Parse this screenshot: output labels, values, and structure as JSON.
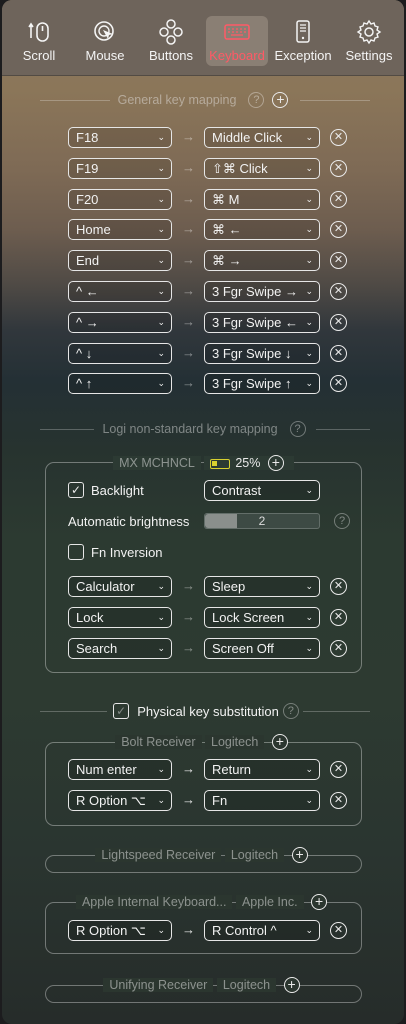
{
  "toolbar": {
    "items": [
      {
        "label": "Scroll",
        "icon": "scroll-icon"
      },
      {
        "label": "Mouse",
        "icon": "mouse-icon"
      },
      {
        "label": "Buttons",
        "icon": "buttons-icon"
      },
      {
        "label": "Keyboard",
        "icon": "keyboard-icon",
        "active": true
      },
      {
        "label": "Exception",
        "icon": "exception-icon"
      },
      {
        "label": "Settings",
        "icon": "gear-icon"
      }
    ],
    "active_color": "#ff5a66"
  },
  "general": {
    "title": "General key mapping",
    "help": "?",
    "rows": [
      {
        "from": "F18",
        "to": "Middle Click"
      },
      {
        "from": "F19",
        "to": "⇧⌘ Click"
      },
      {
        "from": "F20",
        "to": "⌘ M"
      },
      {
        "from": "Home",
        "to": "⌘ ←"
      },
      {
        "from": "End",
        "to": "⌘ →"
      },
      {
        "from": "^ ←",
        "to": "3 Fgr Swipe →"
      },
      {
        "from": "^ →",
        "to": "3 Fgr Swipe ←"
      },
      {
        "from": "^ ↓",
        "to": "3 Fgr Swipe ↓"
      },
      {
        "from": "^ ↑",
        "to": "3 Fgr Swipe ↑"
      }
    ]
  },
  "logi": {
    "title": "Logi non-standard key mapping",
    "help": "?",
    "device": "MX MCHNCL",
    "battery": "25%",
    "battery_level": 0.25,
    "backlight_label": "Backlight",
    "backlight_checked": true,
    "backlight_mode": "Contrast",
    "auto_brightness_label": "Automatic brightness",
    "auto_brightness_value": "2",
    "auto_brightness_level": 0.28,
    "fn_inversion_label": "Fn Inversion",
    "fn_inversion_checked": false,
    "rows": [
      {
        "from": "Calculator",
        "to": "Sleep"
      },
      {
        "from": "Lock",
        "to": "Lock Screen"
      },
      {
        "from": "Search",
        "to": "Screen Off"
      }
    ]
  },
  "physical": {
    "label": "Physical key substitution",
    "checked": true,
    "help": "?",
    "groups": [
      {
        "name": "Bolt Receiver",
        "vendor": "Logitech",
        "rows": [
          {
            "from": "Num enter",
            "to": "Return"
          },
          {
            "from": "R Option ⌥",
            "to": "Fn"
          }
        ]
      },
      {
        "name": "Lightspeed Receiver",
        "vendor": "Logitech",
        "rows": []
      },
      {
        "name": "Apple Internal Keyboard...",
        "vendor": "Apple Inc.",
        "rows": [
          {
            "from": "R Option ⌥",
            "to": "R Control ^"
          }
        ]
      },
      {
        "name": "Unifying Receiver",
        "vendor": "Logitech",
        "rows": []
      }
    ]
  },
  "glyphs": {
    "arrow": "→",
    "chevron": "⌄",
    "remove": "✕",
    "add": "+",
    "check": "✓"
  }
}
